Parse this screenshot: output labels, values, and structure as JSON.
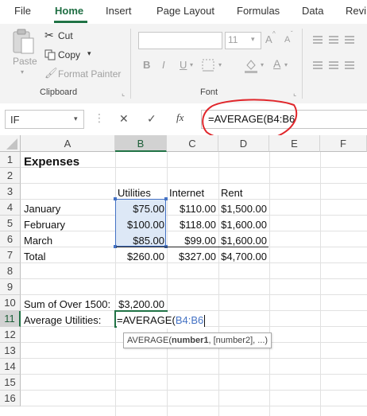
{
  "ribbon_tabs": [
    "File",
    "Home",
    "Insert",
    "Page Layout",
    "Formulas",
    "Data",
    "Revi"
  ],
  "clipboard": {
    "cut": "Cut",
    "copy": "Copy",
    "paste": "Paste",
    "format_painter": "Format Painter",
    "group_label": "Clipboard"
  },
  "font": {
    "size": "11",
    "bold": "B",
    "italic": "I",
    "underline": "U",
    "grow": "A",
    "shrink": "A",
    "font_color": "A",
    "group_label": "Font"
  },
  "formula_bar": {
    "name_box": "IF",
    "cancel": "✕",
    "enter": "✓",
    "fx": "fx",
    "formula": "=AVERAGE(B4:B6"
  },
  "columns": [
    "A",
    "B",
    "C",
    "D",
    "E",
    "F"
  ],
  "rows": [
    "1",
    "2",
    "3",
    "4",
    "5",
    "6",
    "7",
    "8",
    "9",
    "10",
    "11",
    "12",
    "13",
    "14",
    "15",
    "16"
  ],
  "sheet": {
    "title": "Expenses",
    "headers": {
      "utilities": "Utilities",
      "internet": "Internet",
      "rent": "Rent"
    },
    "data": [
      {
        "month": "January",
        "utilities": "$75.00",
        "internet": "$110.00",
        "rent": "$1,500.00"
      },
      {
        "month": "February",
        "utilities": "$100.00",
        "internet": "$118.00",
        "rent": "$1,600.00"
      },
      {
        "month": "March",
        "utilities": "$85.00",
        "internet": "$99.00",
        "rent": "$1,600.00"
      }
    ],
    "total": {
      "label": "Total",
      "utilities": "$260.00",
      "internet": "$327.00",
      "rent": "$4,700.00"
    },
    "sum_over": {
      "label": "Sum of Over 1500:",
      "value": "$3,200.00"
    },
    "avg": {
      "label": "Average Utilities:",
      "formula_prefix": "=AVERAGE(",
      "formula_ref": "B4:B6"
    }
  },
  "tooltip": {
    "fn": "AVERAGE(",
    "arg1": "number1",
    "rest": ", [number2], ...)"
  },
  "colors": {
    "accent": "#217346",
    "ref_blue": "#4472c4",
    "annotation": "#e0262b"
  }
}
